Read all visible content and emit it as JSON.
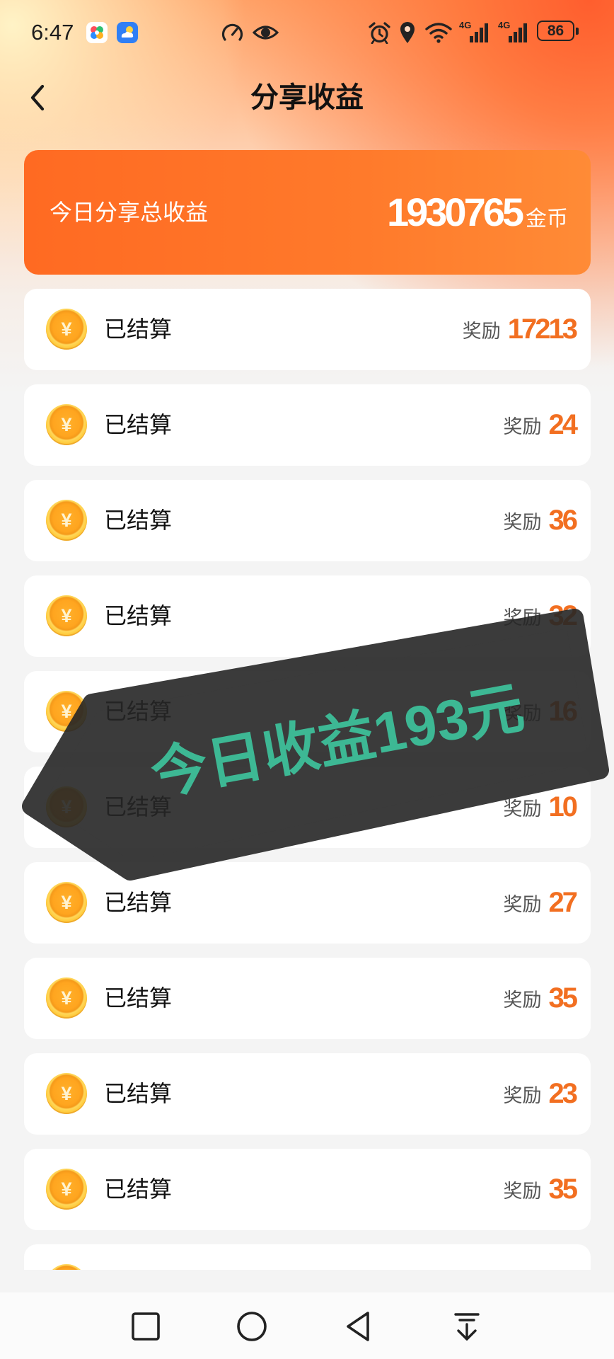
{
  "status_bar": {
    "time": "6:47",
    "network_1": "4G",
    "network_2": "4G",
    "battery": "86"
  },
  "header": {
    "title": "分享收益"
  },
  "summary": {
    "label": "今日分享总收益",
    "amount": "1930765",
    "unit": "金币"
  },
  "list": {
    "coin_symbol": "¥"
  },
  "records": [
    {
      "status": "已结算",
      "reward_label": "奖励",
      "reward": "17213"
    },
    {
      "status": "已结算",
      "reward_label": "奖励",
      "reward": "24"
    },
    {
      "status": "已结算",
      "reward_label": "奖励",
      "reward": "36"
    },
    {
      "status": "已结算",
      "reward_label": "奖励",
      "reward": "32"
    },
    {
      "status": "已结算",
      "reward_label": "奖励",
      "reward": "16"
    },
    {
      "status": "已结算",
      "reward_label": "奖励",
      "reward": "10"
    },
    {
      "status": "已结算",
      "reward_label": "奖励",
      "reward": "27"
    },
    {
      "status": "已结算",
      "reward_label": "奖励",
      "reward": "35"
    },
    {
      "status": "已结算",
      "reward_label": "奖励",
      "reward": "23"
    },
    {
      "status": "已结算",
      "reward_label": "奖励",
      "reward": "35"
    }
  ],
  "overlay": {
    "text": "今日收益193元"
  },
  "colors": {
    "accent": "#ff7328",
    "reward": "#f26f21",
    "overlay_text": "#3db894",
    "overlay_bg": "#262626"
  },
  "icons": {
    "status_bar": [
      "app-icon",
      "weather-app-icon",
      "speedometer-icon",
      "eye-icon",
      "alarm-icon",
      "location-icon",
      "wifi-icon",
      "signal-icon",
      "signal-icon",
      "battery-icon"
    ],
    "header": [
      "back-chevron-icon"
    ],
    "list": [
      "gold-coin-icon"
    ],
    "nav": [
      "recent-apps-icon",
      "home-icon",
      "back-icon",
      "notification-pulldown-icon"
    ]
  }
}
